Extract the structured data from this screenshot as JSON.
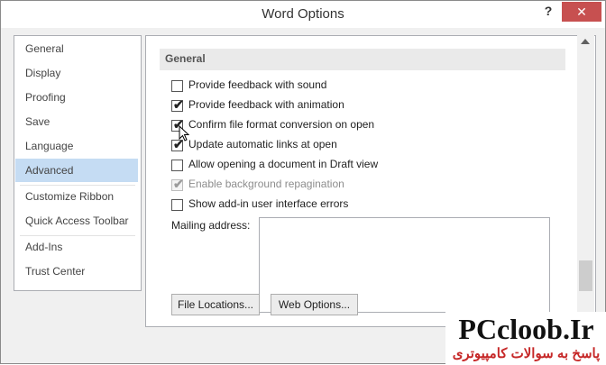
{
  "window": {
    "title": "Word Options",
    "help_label": "?",
    "close_label": "✕"
  },
  "sidebar": {
    "items": [
      {
        "label": "General",
        "selected": false
      },
      {
        "label": "Display",
        "selected": false
      },
      {
        "label": "Proofing",
        "selected": false
      },
      {
        "label": "Save",
        "selected": false
      },
      {
        "label": "Language",
        "selected": false
      },
      {
        "label": "Advanced",
        "selected": true
      },
      {
        "label": "Customize Ribbon",
        "selected": false
      },
      {
        "label": "Quick Access Toolbar",
        "selected": false
      },
      {
        "label": "Add-Ins",
        "selected": false
      },
      {
        "label": "Trust Center",
        "selected": false
      }
    ]
  },
  "main": {
    "section_title": "General",
    "options": [
      {
        "label": "Provide feedback with sound",
        "checked": false,
        "enabled": true
      },
      {
        "label": "Provide feedback with animation",
        "checked": true,
        "enabled": true
      },
      {
        "label": "Confirm file format conversion on open",
        "checked": true,
        "enabled": true
      },
      {
        "label": "Update automatic links at open",
        "checked": true,
        "enabled": true
      },
      {
        "label": "Allow opening a document in Draft view",
        "checked": false,
        "enabled": true
      },
      {
        "label": "Enable background repagination",
        "checked": true,
        "enabled": false
      },
      {
        "label": "Show add-in user interface errors",
        "checked": false,
        "enabled": true
      }
    ],
    "mailing_label": "Mailing address:",
    "mailing_value": "",
    "file_locations_label": "File Locations...",
    "web_options_label": "Web Options...",
    "checkmark": "✔"
  },
  "watermark": {
    "brand": "PCcloob.Ir",
    "subtitle": "پاسخ به سوالات کامپیوتری"
  }
}
